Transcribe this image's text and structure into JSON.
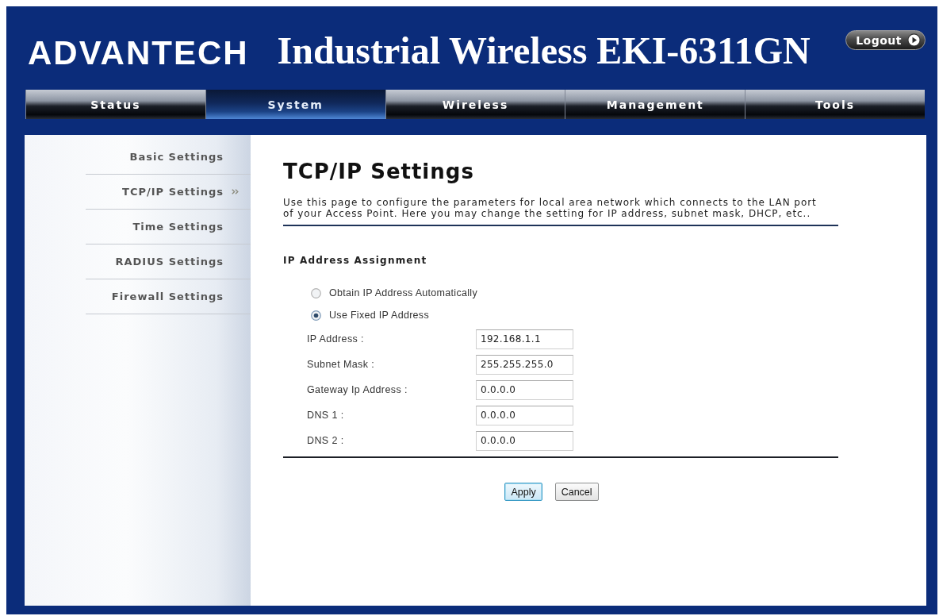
{
  "header": {
    "logo": "ADVANTECH",
    "title": "Industrial Wireless EKI-6311GN",
    "logout_button": "Logout"
  },
  "tabs": [
    {
      "label": "Status",
      "selected": false
    },
    {
      "label": "System",
      "selected": true
    },
    {
      "label": "Wireless",
      "selected": false
    },
    {
      "label": "Management",
      "selected": false
    },
    {
      "label": "Tools",
      "selected": false
    }
  ],
  "sidebar": {
    "items": [
      {
        "label": "Basic Settings",
        "selected": false
      },
      {
        "label": "TCP/IP Settings",
        "selected": true
      },
      {
        "label": "Time Settings",
        "selected": false
      },
      {
        "label": "RADIUS Settings",
        "selected": false
      },
      {
        "label": "Firewall Settings",
        "selected": false
      }
    ]
  },
  "page": {
    "title": "TCP/IP Settings",
    "description": "Use this page to configure the parameters for local area network which connects to the LAN port of your Access Point. Here you may change the setting for IP address, subnet mask, DHCP, etc..",
    "section_title": "IP Address Assignment",
    "ip_assignment": [
      {
        "label": "Obtain IP Address Automatically",
        "selected": false
      },
      {
        "label": "Use Fixed IP Address",
        "selected": true
      }
    ],
    "fields": [
      {
        "label": "IP Address :",
        "value": "192.168.1.1"
      },
      {
        "label": "Subnet Mask :",
        "value": "255.255.255.0"
      },
      {
        "label": "Gateway Ip Address :",
        "value": "0.0.0.0"
      },
      {
        "label": "DNS 1 :",
        "value": "0.0.0.0"
      },
      {
        "label": "DNS 2 :",
        "value": "0.0.0.0"
      }
    ],
    "buttons": [
      {
        "label": "Apply",
        "focused": true
      },
      {
        "label": "Cancel",
        "focused": false
      }
    ]
  }
}
